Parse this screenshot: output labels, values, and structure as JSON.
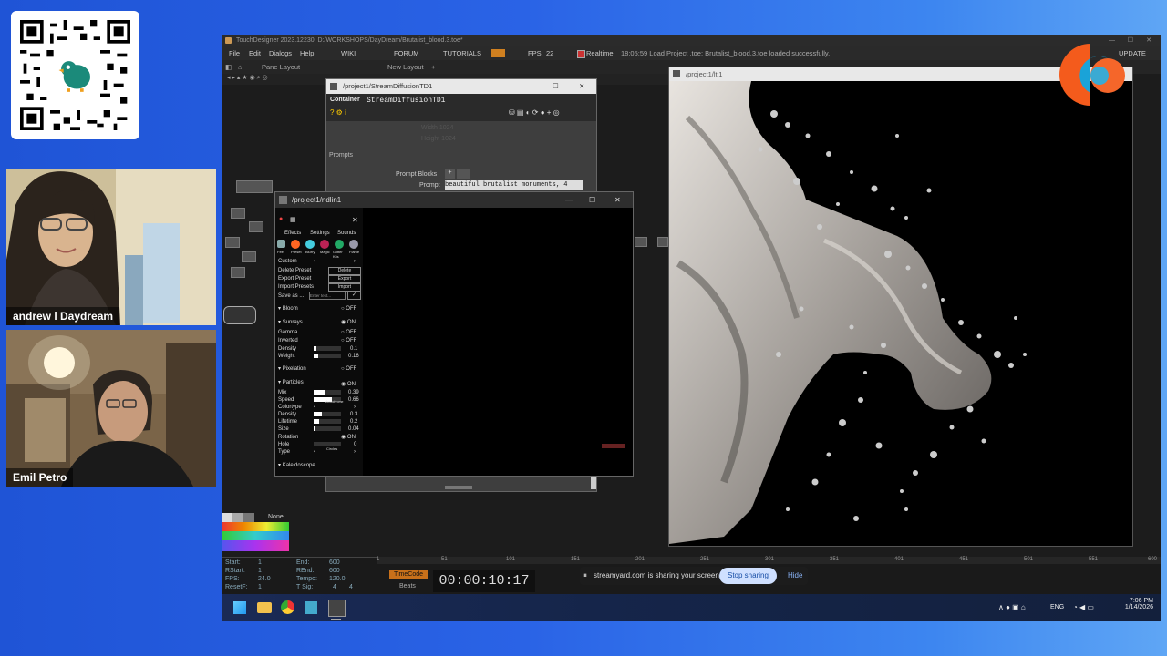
{
  "webcams": [
    {
      "name": "andrew l Daydream"
    },
    {
      "name": "Emil Petro"
    }
  ],
  "app": {
    "title": "TouchDesigner 2023.12230: D:/WORKSHOPS/DayDream/Brutalist_blood.3.toe*",
    "menu": [
      "File",
      "Edit",
      "Dialogs",
      "Help"
    ],
    "menu_links": [
      "WIKI",
      "FORUM",
      "TUTORIALS"
    ],
    "fps_label": "FPS:",
    "fps_value": "22",
    "realtime": "Realtime",
    "status": "18:05:59 Load Project .toe: Brutalist_blood.3.toe loaded successfully.",
    "update": "UPDATE",
    "pane_layout": "Pane Layout",
    "new_layout": "New Layout"
  },
  "sd_window": {
    "path": "/project1/StreamDiffusionTD1",
    "container": "Container",
    "name": "StreamDiffusionTD1",
    "faded1": "Width 1024",
    "faded2": "Height 1024",
    "prompts": "Prompts",
    "prompt_blocks": "Prompt Blocks",
    "prompt_label": "Prompt",
    "prompt_value": "beautiful brutalist monuments, 4"
  },
  "nd_window": {
    "path": "/project1/ndlin1",
    "tabs": [
      "Effects",
      "Settings",
      "Sounds"
    ],
    "preset_labels": [
      "Feel",
      "Preset",
      "Blurry",
      "Magic",
      "Glitter Kits",
      "Flame"
    ],
    "custom": "Custom",
    "delete_preset": "Delete Preset",
    "delete_btn": "Delete",
    "export_preset": "Export Preset",
    "export_btn": "Export",
    "import_presets": "Import Presets",
    "import_btn": "Import",
    "save_as": "Save as ...",
    "enter_text": "Enter text...",
    "bloom": "Bloom",
    "bloom_state": "OFF",
    "sunrays": "Sunrays",
    "sunrays_state": "ON",
    "gamma": "Gamma",
    "gamma_state": "OFF",
    "inverted": "Inverted",
    "inverted_state": "OFF",
    "density": "Density",
    "density_val": "0.1",
    "weight": "Weight",
    "weight_val": "0.16",
    "pixelation": "Pixelation",
    "pixelation_state": "OFF",
    "particles": "Particles",
    "particles_state": "ON",
    "mix": "Mix",
    "mix_val": "0.39",
    "speed": "Speed",
    "speed_val": "0.66",
    "colortype": "Colortype",
    "colortype_val": "Monochrome",
    "p_density": "Density",
    "p_density_val": "0.3",
    "lifetime": "Lifetime",
    "lifetime_val": "0.2",
    "size": "Size",
    "size_val": "0.04",
    "rotation": "Rotation",
    "rotation_state": "ON",
    "hole": "Hole",
    "hole_val": "0",
    "type": "Type",
    "type_val": "Circles",
    "kaleidoscope": "Kaleidoscope"
  },
  "res_window": {
    "path": "/project1/lti1"
  },
  "palette": {
    "none": "None"
  },
  "timeline": {
    "start": "Start:",
    "start_v": "1",
    "rstart": "RStart:",
    "rstart_v": "1",
    "fps": "FPS:",
    "fps_v": "24.0",
    "resetf": "ResetF:",
    "resetf_v": "1",
    "end": "End:",
    "end_v": "600",
    "rend": "REnd:",
    "rend_v": "600",
    "tempo": "Tempo:",
    "tempo_v": "120.0",
    "tsig": "T Sig:",
    "tsig_a": "4",
    "tsig_b": "4",
    "timecode": "TimeCode",
    "beats": "Beats",
    "time": "00:00:10:17",
    "ticks": [
      "1",
      "51",
      "101",
      "151",
      "201",
      "251",
      "301",
      "351",
      "401",
      "451",
      "501",
      "551",
      "600"
    ]
  },
  "share": {
    "message": "streamyard.com is sharing your screen.",
    "stop": "Stop sharing",
    "hide": "Hide"
  },
  "tray": {
    "lang": "ENG",
    "time": "7:06 PM",
    "date": "1/14/2026"
  }
}
